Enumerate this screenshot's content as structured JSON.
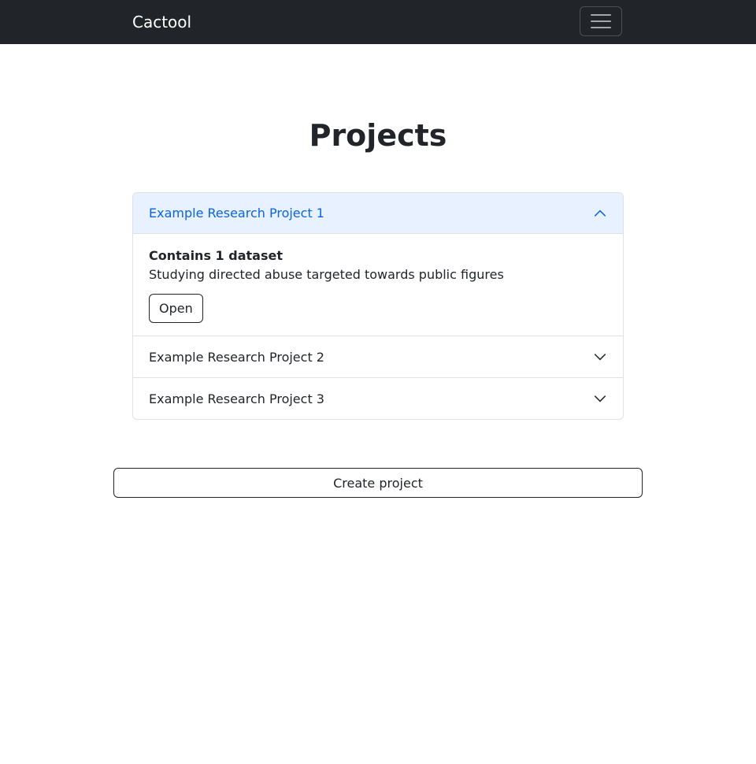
{
  "navbar": {
    "brand": "Cactool",
    "toggler_icon": "hamburger-menu-icon"
  },
  "page": {
    "title": "Projects"
  },
  "projects": [
    {
      "title": "Example Research Project 1",
      "expanded": true,
      "dataset_count": "Contains 1 dataset",
      "description": "Studying directed abuse targeted towards public figures",
      "open_label": "Open",
      "chevron_icon": "chevron-up-icon"
    },
    {
      "title": "Example Research Project 2",
      "expanded": false,
      "chevron_icon": "chevron-down-icon"
    },
    {
      "title": "Example Research Project 3",
      "expanded": false,
      "chevron_icon": "chevron-down-icon"
    }
  ],
  "actions": {
    "create_label": "Create project"
  },
  "colors": {
    "navbar_bg": "#212529",
    "accordion_active_bg": "#e7f1ff",
    "accordion_active_text": "#0c63e4"
  }
}
